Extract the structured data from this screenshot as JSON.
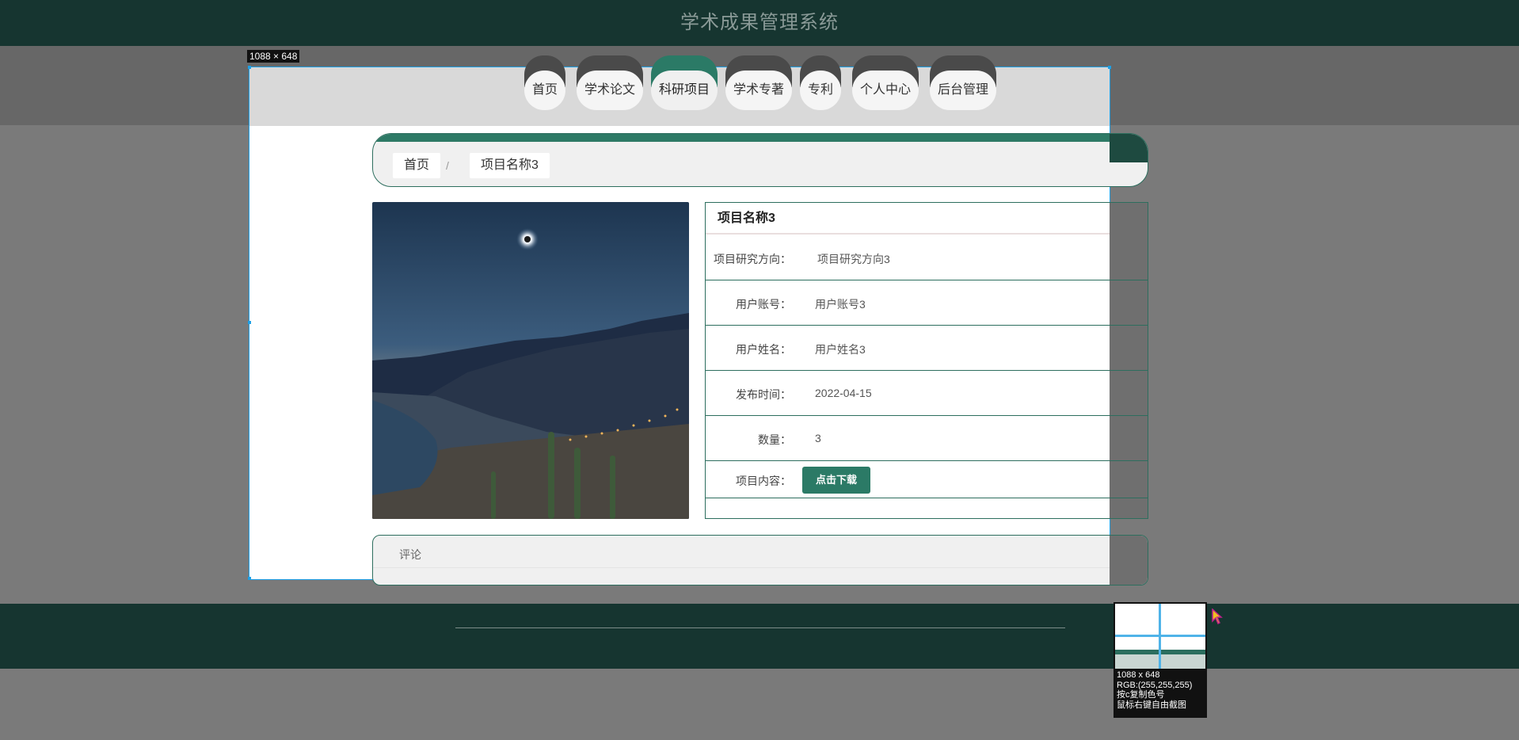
{
  "header": {
    "title": "学术成果管理系统"
  },
  "capture": {
    "size_label": "1088 × 648",
    "magnifier": {
      "size": "1088 x 648",
      "rgb": "RGB:(255,255,255)",
      "hint_copy": "按c复制色号",
      "hint_free": "鼠标右键自由截图"
    }
  },
  "nav": {
    "items": [
      {
        "label": "首页"
      },
      {
        "label": "学术论文"
      },
      {
        "label": "科研项目"
      },
      {
        "label": "学术专著"
      },
      {
        "label": "专利"
      },
      {
        "label": "个人中心"
      },
      {
        "label": "后台管理"
      }
    ],
    "active_index": 2
  },
  "breadcrumb": {
    "home": "首页",
    "separator": "/",
    "current": "项目名称3"
  },
  "detail": {
    "title": "项目名称3",
    "fields": [
      {
        "label": "项目研究方向：",
        "value": "项目研究方向3"
      },
      {
        "label": "用户账号：",
        "value": "用户账号3"
      },
      {
        "label": "用户姓名：",
        "value": "用户姓名3"
      },
      {
        "label": "发布时间：",
        "value": "2022-04-15"
      },
      {
        "label": "数量：",
        "value": "3"
      }
    ],
    "content_label": "项目内容：",
    "download_button": "点击下载"
  },
  "comments": {
    "label": "评论"
  },
  "colors": {
    "header_bg": "#163530",
    "accent": "#2b7a66",
    "capture_border": "#1ea0e6"
  }
}
